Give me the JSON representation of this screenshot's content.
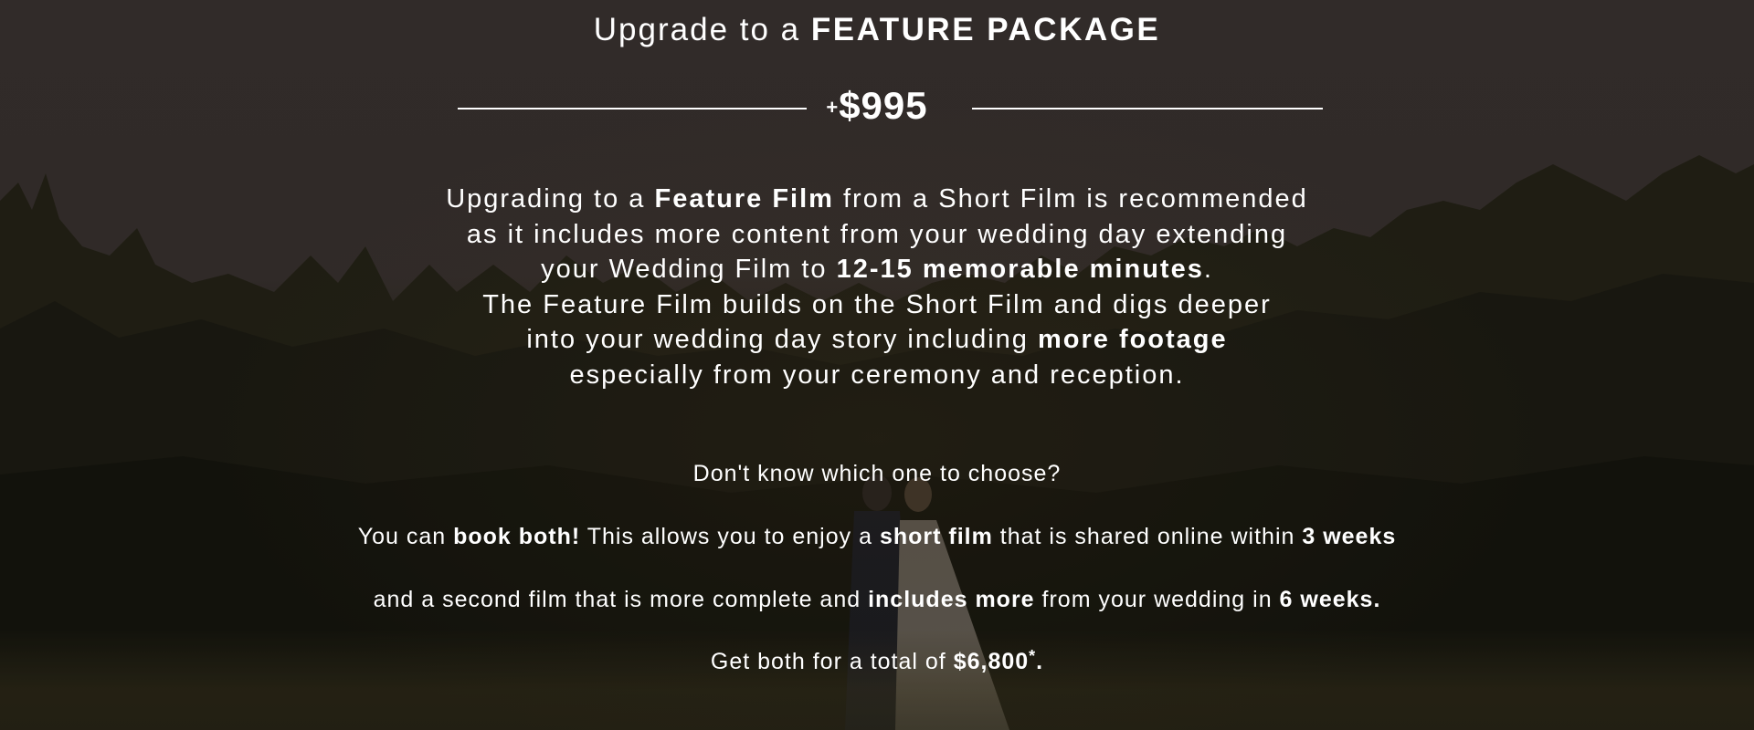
{
  "header": {
    "title_prefix": "Upgrade to a ",
    "title_emphasis": "FEATURE PACKAGE"
  },
  "price": {
    "prefix": "+",
    "amount": "$995"
  },
  "description": {
    "line1_a": "Upgrading to a ",
    "line1_b": "Feature Film",
    "line1_c": " from a Short Film is recommended",
    "line2": "as it includes more content from your wedding day extending",
    "line3_a": "your Wedding Film to ",
    "line3_b": "12-15 memorable minutes",
    "line3_c": ".",
    "line4": "The Feature Film builds on the Short Film and digs deeper",
    "line5_a": "into your wedding day story including ",
    "line5_b": "more footage",
    "line6": "especially from your ceremony and reception."
  },
  "choice": {
    "question": "Don't know which one to choose?",
    "l1_a": "You can ",
    "l1_b": "book both!",
    "l1_c": " This allows you to enjoy a ",
    "l1_d": "short film",
    "l1_e": " that is shared online within ",
    "l1_f": "3 weeks",
    "l2_a": "and a second film that is more complete and ",
    "l2_b": "includes more",
    "l2_c": " from your wedding in ",
    "l2_d": "6 weeks.",
    "l3_a": "Get both for a total of ",
    "l3_b": "$6,800",
    "l3_c": "*",
    "l3_d": "."
  },
  "colors": {
    "text": "#ffffff",
    "background": "#3a3330"
  }
}
